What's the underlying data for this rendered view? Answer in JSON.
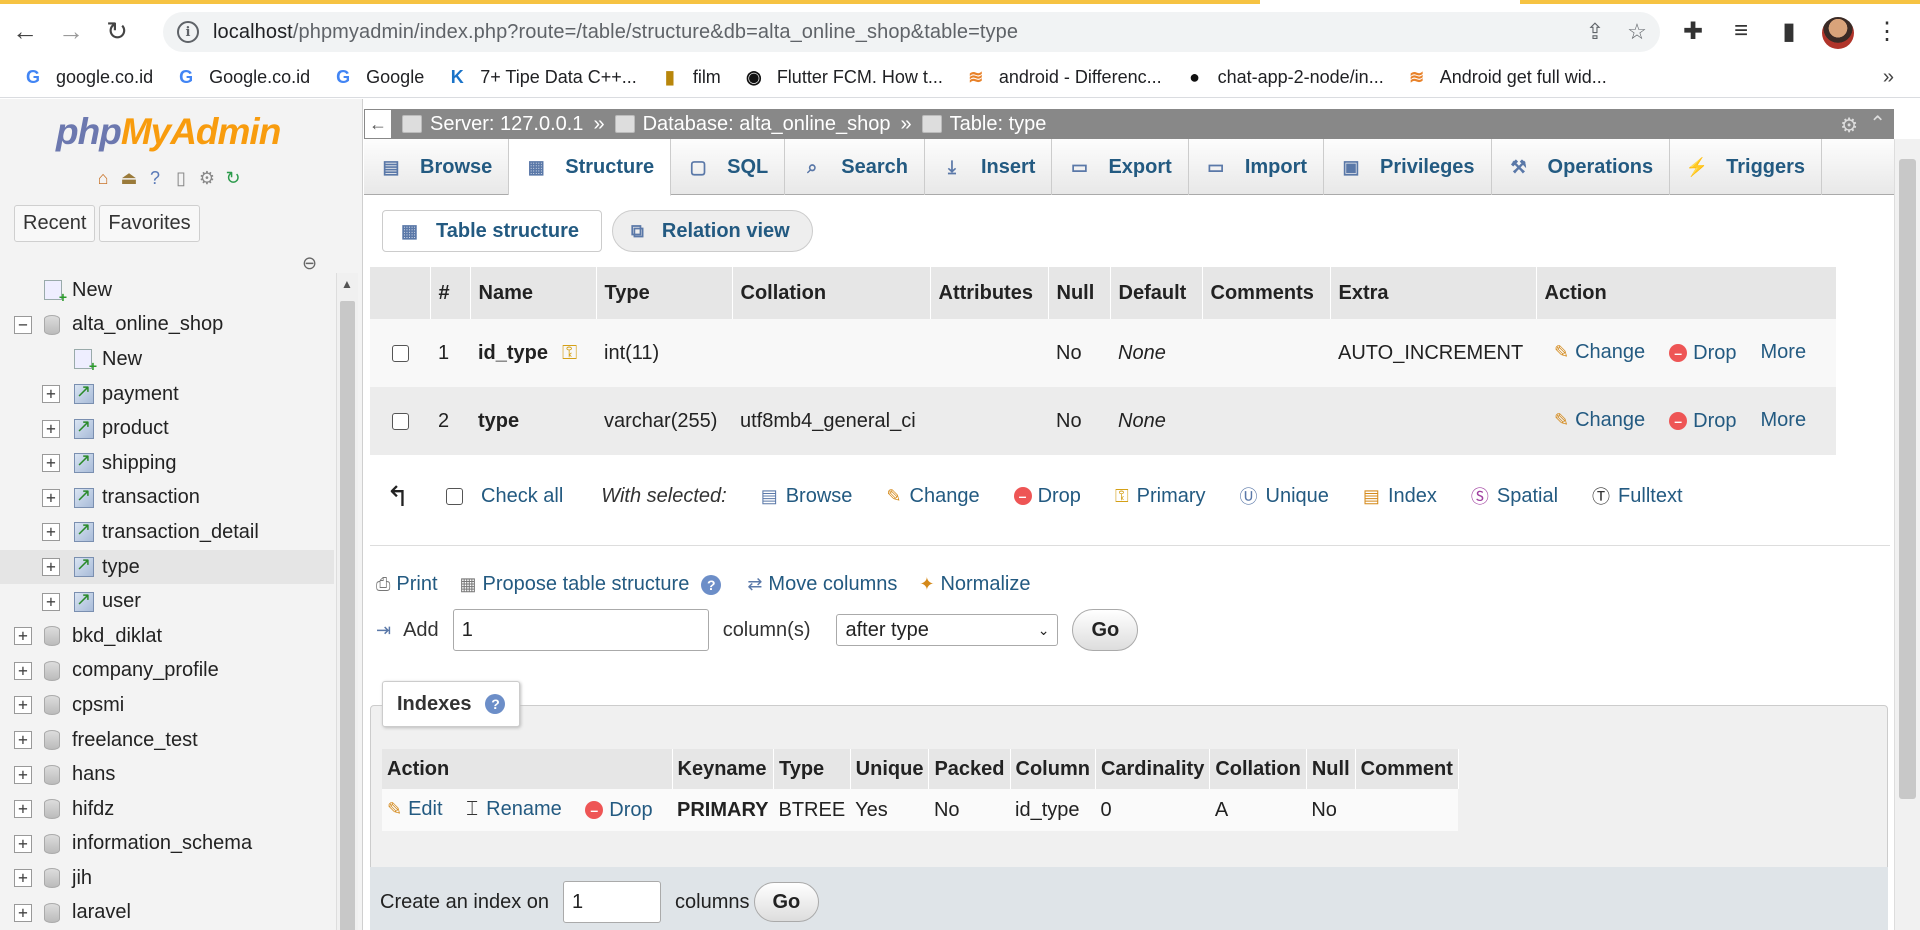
{
  "browser": {
    "url_host": "localhost",
    "url_path": "/phpmyadmin/index.php?route=/table/structure&db=alta_online_shop&table=type",
    "bookmarks": [
      {
        "label": "google.co.id",
        "icon": "G"
      },
      {
        "label": "Google.co.id",
        "icon": "G"
      },
      {
        "label": "Google",
        "icon": "G"
      },
      {
        "label": "7+ Tipe Data C++...",
        "icon": "K"
      },
      {
        "label": "film",
        "icon": "▮"
      },
      {
        "label": "Flutter FCM. How t...",
        "icon": "◉"
      },
      {
        "label": "android - Differenc...",
        "icon": "≋"
      },
      {
        "label": "chat-app-2-node/in...",
        "icon": "●"
      },
      {
        "label": "Android get full wid...",
        "icon": "≋"
      }
    ]
  },
  "sidebar": {
    "logo_php": "php",
    "logo_ma": "MyAdmin",
    "tabs": [
      "Recent",
      "Favorites"
    ],
    "tree": [
      {
        "label": "New",
        "level": 0,
        "kind": "new"
      },
      {
        "label": "alta_online_shop",
        "level": 0,
        "kind": "db",
        "expanded": true
      },
      {
        "label": "New",
        "level": 1,
        "kind": "new"
      },
      {
        "label": "payment",
        "level": 1,
        "kind": "table"
      },
      {
        "label": "product",
        "level": 1,
        "kind": "table"
      },
      {
        "label": "shipping",
        "level": 1,
        "kind": "table"
      },
      {
        "label": "transaction",
        "level": 1,
        "kind": "table"
      },
      {
        "label": "transaction_detail",
        "level": 1,
        "kind": "table"
      },
      {
        "label": "type",
        "level": 1,
        "kind": "table",
        "selected": true
      },
      {
        "label": "user",
        "level": 1,
        "kind": "table"
      },
      {
        "label": "bkd_diklat",
        "level": 0,
        "kind": "db"
      },
      {
        "label": "company_profile",
        "level": 0,
        "kind": "db"
      },
      {
        "label": "cpsmi",
        "level": 0,
        "kind": "db"
      },
      {
        "label": "freelance_test",
        "level": 0,
        "kind": "db"
      },
      {
        "label": "hans",
        "level": 0,
        "kind": "db"
      },
      {
        "label": "hifdz",
        "level": 0,
        "kind": "db"
      },
      {
        "label": "information_schema",
        "level": 0,
        "kind": "db"
      },
      {
        "label": "jih",
        "level": 0,
        "kind": "db"
      },
      {
        "label": "laravel",
        "level": 0,
        "kind": "db"
      }
    ]
  },
  "breadcrumb": {
    "server": "Server: 127.0.0.1",
    "database": "Database: alta_online_shop",
    "table": "Table: type",
    "sep": "»"
  },
  "tabs": [
    "Browse",
    "Structure",
    "SQL",
    "Search",
    "Insert",
    "Export",
    "Import",
    "Privileges",
    "Operations",
    "Triggers"
  ],
  "subtabs": {
    "table_structure": "Table structure",
    "relation_view": "Relation view"
  },
  "structure": {
    "headers": [
      "#",
      "Name",
      "Type",
      "Collation",
      "Attributes",
      "Null",
      "Default",
      "Comments",
      "Extra",
      "Action"
    ],
    "rows": [
      {
        "num": "1",
        "name": "id_type",
        "type": "int(11)",
        "collation": "",
        "attributes": "",
        "null": "No",
        "default": "None",
        "comments": "",
        "extra": "AUTO_INCREMENT",
        "primary": true
      },
      {
        "num": "2",
        "name": "type",
        "type": "varchar(255)",
        "collation": "utf8mb4_general_ci",
        "attributes": "",
        "null": "No",
        "default": "None",
        "comments": "",
        "extra": "",
        "primary": false
      }
    ],
    "actions": {
      "change": "Change",
      "drop": "Drop",
      "more": "More"
    }
  },
  "with_selected": {
    "check_all": "Check all",
    "label": "With selected:",
    "items": [
      "Browse",
      "Change",
      "Drop",
      "Primary",
      "Unique",
      "Index",
      "Spatial",
      "Fulltext"
    ]
  },
  "tools": {
    "print": "Print",
    "propose": "Propose table structure",
    "move": "Move columns",
    "normalize": "Normalize"
  },
  "add": {
    "label": "Add",
    "value": "1",
    "unit": "column(s)",
    "position": "after type",
    "go": "Go"
  },
  "indexes": {
    "title": "Indexes",
    "headers": [
      "Action",
      "Keyname",
      "Type",
      "Unique",
      "Packed",
      "Column",
      "Cardinality",
      "Collation",
      "Null",
      "Comment"
    ],
    "row": {
      "edit": "Edit",
      "rename": "Rename",
      "drop": "Drop",
      "keyname": "PRIMARY",
      "type": "BTREE",
      "unique": "Yes",
      "packed": "No",
      "column": "id_type",
      "cardinality": "0",
      "collation": "A",
      "null": "No",
      "comment": ""
    },
    "create_label": "Create an index on",
    "create_value": "1",
    "create_unit": "columns",
    "go": "Go"
  }
}
